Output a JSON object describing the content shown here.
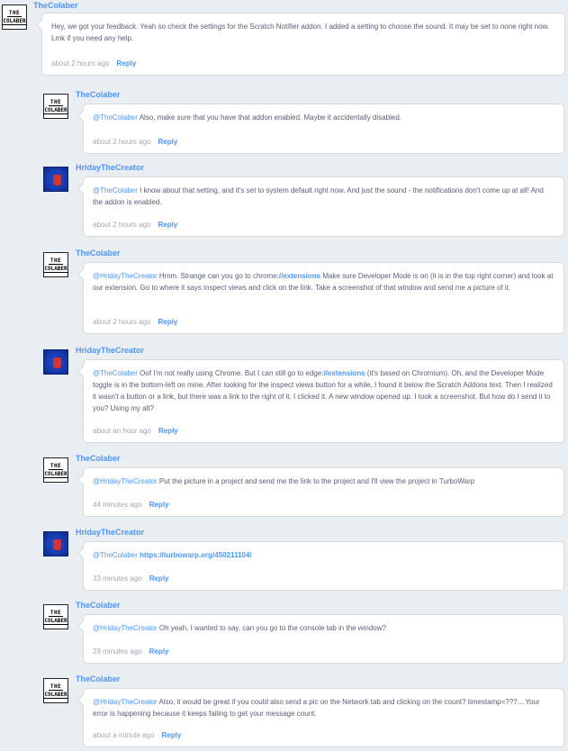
{
  "comments": [
    {
      "user": "TheColaber",
      "avatar": "colaber",
      "text": [
        "Hey, we got your feedback. Yeah so check the settings for the Scratch Notifier addon. I added a setting to choose the sound. It may be set to none right now. Lmk if you need any help."
      ],
      "time": "about 2 hours ago",
      "reply": "Reply"
    },
    {
      "user": "TheColaber",
      "avatar": "colaber",
      "mention": "@TheColaber",
      "text": [
        " Also, make sure that you have that addon enabled. Maybe it accidentally disabled."
      ],
      "time": "about 2 hours ago",
      "reply": "Reply"
    },
    {
      "user": "HridayTheCreator",
      "avatar": "hriday",
      "mention": "@TheColaber",
      "text": [
        " I know about that setting, and it's set to system default right now. And just the sound - the notifications don't come up at all! And the addon is enabled."
      ],
      "time": "about 2 hours ago",
      "reply": "Reply"
    },
    {
      "user": "TheColaber",
      "avatar": "colaber",
      "mention": "@HridayTheCreator",
      "text": [
        " Hmm. Strange can you go to chrome:",
        "//extensions",
        " Make sure Developer Mode is on (it is in the top right corner) and look at our extension. Go to where it says inspect views and click on the link. Take a screenshot of that window and send me a picture of it."
      ],
      "time": "about 2 hours ago",
      "reply": "Reply"
    },
    {
      "user": "HridayTheCreator",
      "avatar": "hriday",
      "mention": "@TheColaber",
      "text": [
        " Oof I'm not really using Chrome. But I can still go to edge:",
        "//extensions",
        " (it's based on Chromium). Oh, and the Developer Mode toggle is in the bottom-left on mine. After looking for the inspect views button for a while, I found it below the Scratch Addons text. Then I realized it wasn't a button or a link, but there was a link to the right of it. I clicked it. A new window opened up. I took a screenshot. But how do I send it to you? Using my alt?"
      ],
      "time": "about an hour ago",
      "reply": "Reply"
    },
    {
      "user": "TheColaber",
      "avatar": "colaber",
      "mention": "@HridayTheCreator",
      "text": [
        " Put the picture in a project and send me the link to the project and I'll view the project in TurboWarp"
      ],
      "time": "44 minutes ago",
      "reply": "Reply"
    },
    {
      "user": "HridayTheCreator",
      "avatar": "hriday",
      "mention": "@TheColaber",
      "text": [
        " ",
        "https://turbowarp.org/450211104/"
      ],
      "time": "33 minutes ago",
      "reply": "Reply"
    },
    {
      "user": "TheColaber",
      "avatar": "colaber",
      "mention": "@HridayTheCreator",
      "text": [
        " Oh yeah, I wanted to say, can you go to the console tab in the window?"
      ],
      "time": "29 minutes ago",
      "reply": "Reply"
    },
    {
      "user": "TheColaber",
      "avatar": "colaber",
      "mention": "@HridayTheCreator",
      "text": [
        " Also, it would be great if you could also send a pic on the Network tab and clicking on the count? timestamp=???... Your error is happening because it keeps failing to get your message count."
      ],
      "time": "about a minute ago",
      "reply": "Reply"
    }
  ],
  "avatar_text": {
    "line1": "THE",
    "line2": "COLABER"
  }
}
